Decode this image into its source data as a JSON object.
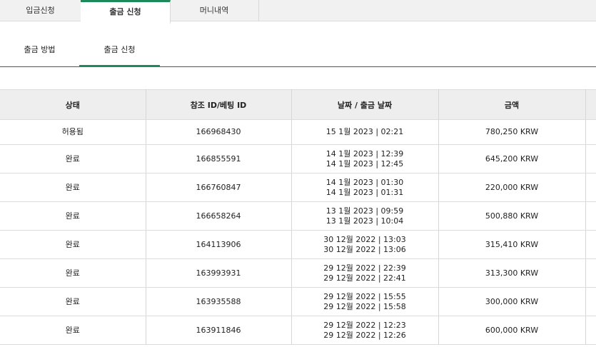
{
  "top_tabs": [
    {
      "label": "입금신청",
      "active": false
    },
    {
      "label": "출금 신청",
      "active": true
    },
    {
      "label": "머니내역",
      "active": false
    }
  ],
  "sub_tabs": [
    {
      "label": "출금 방법",
      "active": false
    },
    {
      "label": "출금 신청",
      "active": true
    }
  ],
  "table": {
    "headers": [
      "상태",
      "참조 ID/베팅 ID",
      "날짜 / 출금 날짜",
      "금액",
      ""
    ],
    "rows": [
      {
        "status": "허용됨",
        "ref": "166968430",
        "dates": [
          "15 1월 2023 | 02:21"
        ],
        "amount": "780,250 KRW"
      },
      {
        "status": "완료",
        "ref": "166855591",
        "dates": [
          "14 1월 2023 | 12:39",
          "14 1월 2023 | 12:45"
        ],
        "amount": "645,200 KRW"
      },
      {
        "status": "완료",
        "ref": "166760847",
        "dates": [
          "14 1월 2023 | 01:30",
          "14 1월 2023 | 01:31"
        ],
        "amount": "220,000 KRW"
      },
      {
        "status": "완료",
        "ref": "166658264",
        "dates": [
          "13 1월 2023 | 09:59",
          "13 1월 2023 | 10:04"
        ],
        "amount": "500,880 KRW"
      },
      {
        "status": "완료",
        "ref": "164113906",
        "dates": [
          "30 12월 2022 | 13:03",
          "30 12월 2022 | 13:06"
        ],
        "amount": "315,410 KRW"
      },
      {
        "status": "완료",
        "ref": "163993931",
        "dates": [
          "29 12월 2022 | 22:39",
          "29 12월 2022 | 22:41"
        ],
        "amount": "313,300 KRW"
      },
      {
        "status": "완료",
        "ref": "163935588",
        "dates": [
          "29 12월 2022 | 15:55",
          "29 12월 2022 | 15:58"
        ],
        "amount": "300,000 KRW"
      },
      {
        "status": "완료",
        "ref": "163911846",
        "dates": [
          "29 12월 2022 | 12:23",
          "29 12월 2022 | 12:26"
        ],
        "amount": "600,000 KRW"
      }
    ]
  },
  "colors": {
    "accent": "#1d8a5a",
    "header_bg": "#eeeeee",
    "tab_bar_bg": "#f1f1f1"
  }
}
